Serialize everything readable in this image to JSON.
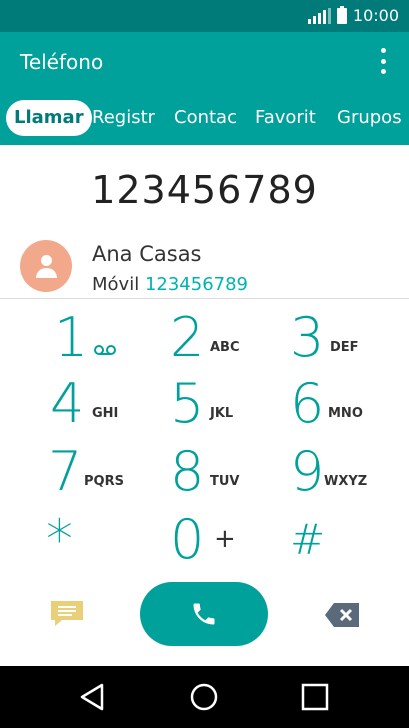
{
  "status": {
    "time": "10:00"
  },
  "appbar": {
    "title": "Teléfono"
  },
  "tabs": [
    {
      "label": "Llamar"
    },
    {
      "label": "Registr"
    },
    {
      "label": "Contac"
    },
    {
      "label": "Favorit"
    },
    {
      "label": "Grupos"
    }
  ],
  "dialed_number": "123456789",
  "contact": {
    "name": "Ana Casas",
    "type": "Móvil",
    "number": "123456789"
  },
  "keypad": [
    {
      "digit": "1",
      "letters": ""
    },
    {
      "digit": "2",
      "letters": "ABC"
    },
    {
      "digit": "3",
      "letters": "DEF"
    },
    {
      "digit": "4",
      "letters": "GHI"
    },
    {
      "digit": "5",
      "letters": "JKL"
    },
    {
      "digit": "6",
      "letters": "MNO"
    },
    {
      "digit": "7",
      "letters": "PQRS"
    },
    {
      "digit": "8",
      "letters": "TUV"
    },
    {
      "digit": "9",
      "letters": "WXYZ"
    },
    {
      "digit": "*",
      "letters": ""
    },
    {
      "digit": "0",
      "letters": "+"
    },
    {
      "digit": "#",
      "letters": ""
    }
  ],
  "colors": {
    "primary": "#00a09b",
    "status_bar": "#007b7a",
    "avatar": "#f2a98b",
    "message": "#e8cf78",
    "delete": "#5a6a7a"
  },
  "icons": {
    "voicemail": "voicemail-icon",
    "message": "message-icon",
    "call": "phone-icon",
    "delete": "backspace-icon",
    "back": "back-triangle-icon",
    "home": "home-circle-icon",
    "recents": "recents-square-icon"
  }
}
